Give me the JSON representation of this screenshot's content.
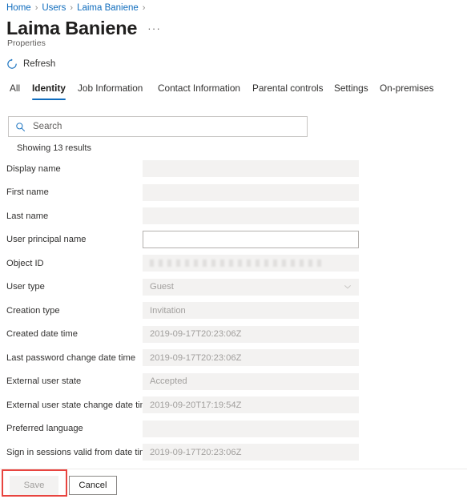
{
  "breadcrumb": {
    "items": [
      "Home",
      "Users",
      "Laima Baniene"
    ],
    "separator": "›",
    "trailing_separator": "›"
  },
  "header": {
    "title": "Laima Baniene",
    "ellipsis": "···",
    "subtitle": "Properties"
  },
  "commandbar": {
    "refresh_label": "Refresh",
    "refresh_icon": "refresh-icon"
  },
  "tabs": [
    {
      "label": "All",
      "active": false
    },
    {
      "label": "Identity",
      "active": true
    },
    {
      "label": "Job Information",
      "active": false
    },
    {
      "label": "Contact Information",
      "active": false
    },
    {
      "label": "Parental controls",
      "active": false
    },
    {
      "label": "Settings",
      "active": false
    },
    {
      "label": "On-premises",
      "active": false
    }
  ],
  "search": {
    "placeholder": "Search",
    "value": "",
    "icon": "search-icon"
  },
  "results": {
    "count_text": "Showing 13 results"
  },
  "fields": [
    {
      "label": "Display name",
      "value": "",
      "type": "readonly"
    },
    {
      "label": "First name",
      "value": "",
      "type": "readonly"
    },
    {
      "label": "Last name",
      "value": "",
      "type": "readonly"
    },
    {
      "label": "User principal name",
      "value": "",
      "type": "editable"
    },
    {
      "label": "Object ID",
      "value": "",
      "type": "redacted"
    },
    {
      "label": "User type",
      "value": "Guest",
      "type": "dropdown"
    },
    {
      "label": "Creation type",
      "value": "Invitation",
      "type": "readonly"
    },
    {
      "label": "Created date time",
      "value": "2019-09-17T20:23:06Z",
      "type": "readonly"
    },
    {
      "label": "Last password change date time",
      "value": "2019-09-17T20:23:06Z",
      "type": "readonly"
    },
    {
      "label": "External user state",
      "value": "Accepted",
      "type": "readonly"
    },
    {
      "label": "External user state change date time",
      "value": "2019-09-20T17:19:54Z",
      "type": "readonly"
    },
    {
      "label": "Preferred language",
      "value": "",
      "type": "readonly"
    },
    {
      "label": "Sign in sessions valid from date time",
      "value": "2019-09-17T20:23:06Z",
      "type": "readonly"
    }
  ],
  "footer": {
    "save_label": "Save",
    "save_disabled": true,
    "cancel_label": "Cancel"
  },
  "colors": {
    "accent": "#0f6cbd",
    "link": "#0f6cbd",
    "highlight": "#e8443f",
    "field_bg": "#f3f2f1",
    "text": "#323130",
    "muted": "#a19f9d"
  },
  "annotation": {
    "highlight_target": "save-button"
  }
}
